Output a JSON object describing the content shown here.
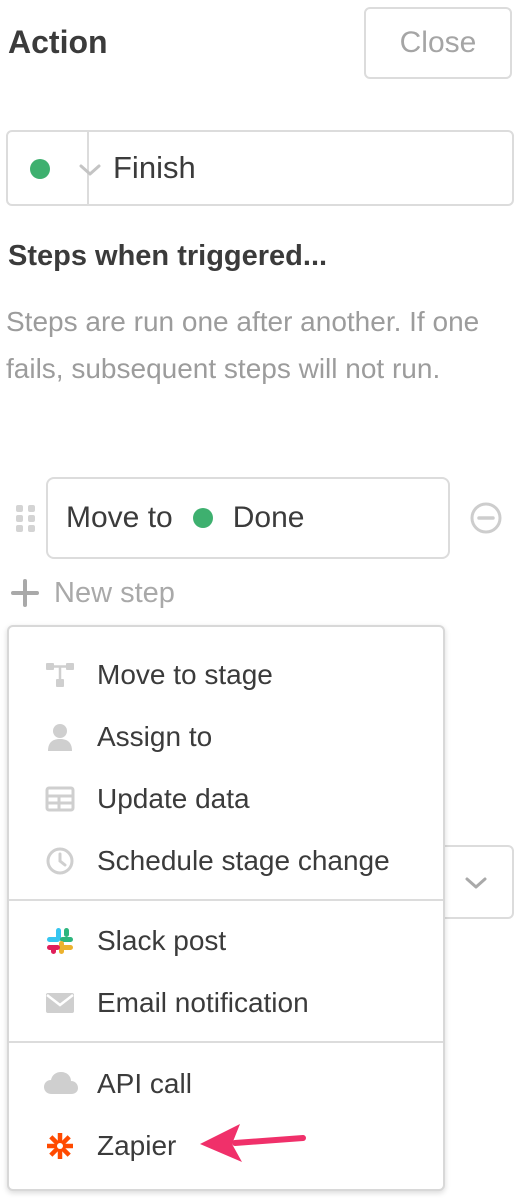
{
  "header": {
    "title": "Action",
    "close_label": "Close"
  },
  "stage": {
    "name": "Finish",
    "dot_color": "#3eb06f"
  },
  "steps_section": {
    "title": "Steps when triggered...",
    "description": "Steps are run one after another. If one fails, subsequent steps will not run."
  },
  "step": {
    "prefix": "Move to",
    "stage_name": "Done",
    "stage_color": "#3eb06f"
  },
  "new_step_label": "New step",
  "menu": {
    "group1": [
      {
        "label": "Move to stage",
        "icon": "flow-icon"
      },
      {
        "label": "Assign to",
        "icon": "user-icon"
      },
      {
        "label": "Update data",
        "icon": "table-icon"
      },
      {
        "label": "Schedule stage change",
        "icon": "clock-icon"
      }
    ],
    "group2": [
      {
        "label": "Slack post",
        "icon": "slack-icon"
      },
      {
        "label": "Email notification",
        "icon": "envelope-icon"
      }
    ],
    "group3": [
      {
        "label": "API call",
        "icon": "cloud-icon"
      },
      {
        "label": "Zapier",
        "icon": "zapier-icon"
      }
    ]
  },
  "colors": {
    "accent_green": "#3eb06f",
    "annotation_arrow": "#f0306a",
    "zapier": "#ff4a00"
  }
}
